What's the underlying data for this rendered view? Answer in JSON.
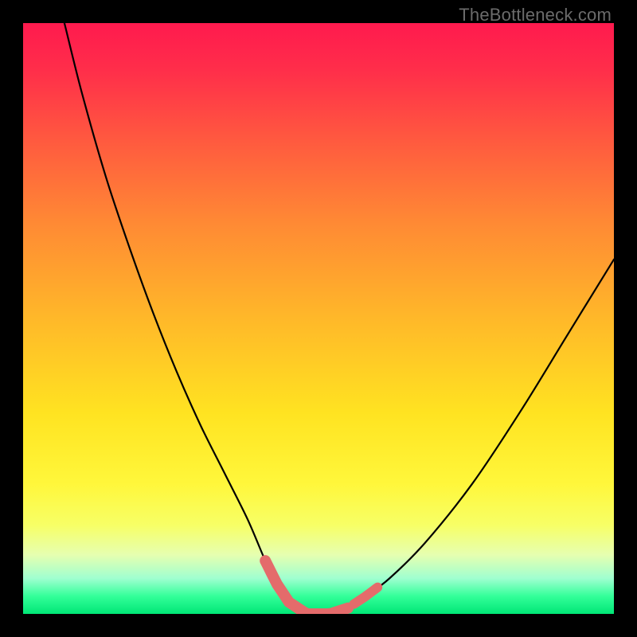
{
  "watermark": "TheBottleneck.com",
  "chart_data": {
    "type": "line",
    "title": "",
    "xlabel": "",
    "ylabel": "",
    "xlim": [
      0,
      100
    ],
    "ylim": [
      0,
      100
    ],
    "series": [
      {
        "name": "bottleneck-curve",
        "x": [
          7,
          10,
          14,
          18,
          22,
          26,
          30,
          34,
          38,
          41,
          43,
          45,
          48,
          52,
          55,
          58,
          62,
          68,
          76,
          84,
          92,
          100
        ],
        "values": [
          100,
          88,
          74,
          62,
          51,
          41,
          32,
          24,
          16,
          9,
          5,
          2,
          0,
          0,
          1,
          3,
          6,
          12,
          22,
          34,
          47,
          60
        ]
      }
    ],
    "annotations": [
      {
        "name": "trough-marker-left",
        "kind": "segment",
        "x_range": [
          41,
          48
        ],
        "color": "#e46b6b"
      },
      {
        "name": "trough-marker-flat",
        "kind": "segment",
        "x_range": [
          47,
          55
        ],
        "color": "#e46b6b"
      },
      {
        "name": "trough-marker-right",
        "kind": "short-segment",
        "x_range": [
          56,
          60
        ],
        "color": "#e46b6b"
      }
    ],
    "background_gradient": {
      "top": "#ff1a4e",
      "middle": "#ffe321",
      "bottom": "#00e676"
    }
  }
}
